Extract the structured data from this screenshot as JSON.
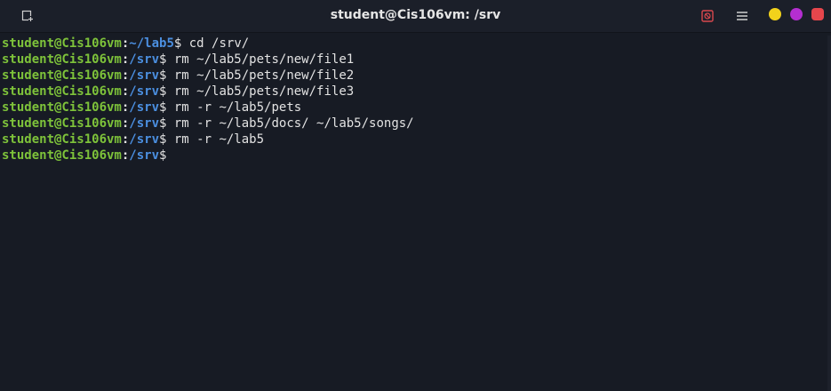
{
  "window": {
    "title": "student@Cis106vm: /srv"
  },
  "icons": {
    "new_tab": "new-tab-icon",
    "record": "recording-icon",
    "menu": "hamburger-menu-icon",
    "minimize_color": "#f2d21b",
    "maximize_color": "#b42ed1",
    "close_color": "#e6464c"
  },
  "colors": {
    "background": "#171b24",
    "user": "#7ec33a",
    "path": "#4b8fe0",
    "text": "#e2e2e2"
  },
  "terminal": {
    "lines": [
      {
        "user": "student@Cis106vm",
        "sep": ":",
        "path": "~/lab5",
        "dollar": "$",
        "cmd": " cd /srv/"
      },
      {
        "user": "student@Cis106vm",
        "sep": ":",
        "path": "/srv",
        "dollar": "$",
        "cmd": " rm ~/lab5/pets/new/file1"
      },
      {
        "user": "student@Cis106vm",
        "sep": ":",
        "path": "/srv",
        "dollar": "$",
        "cmd": " rm ~/lab5/pets/new/file2"
      },
      {
        "user": "student@Cis106vm",
        "sep": ":",
        "path": "/srv",
        "dollar": "$",
        "cmd": " rm ~/lab5/pets/new/file3"
      },
      {
        "user": "student@Cis106vm",
        "sep": ":",
        "path": "/srv",
        "dollar": "$",
        "cmd": " rm -r ~/lab5/pets"
      },
      {
        "user": "student@Cis106vm",
        "sep": ":",
        "path": "/srv",
        "dollar": "$",
        "cmd": " rm -r ~/lab5/docs/ ~/lab5/songs/"
      },
      {
        "user": "student@Cis106vm",
        "sep": ":",
        "path": "/srv",
        "dollar": "$",
        "cmd": " rm -r ~/lab5"
      },
      {
        "user": "student@Cis106vm",
        "sep": ":",
        "path": "/srv",
        "dollar": "$",
        "cmd": ""
      }
    ]
  }
}
